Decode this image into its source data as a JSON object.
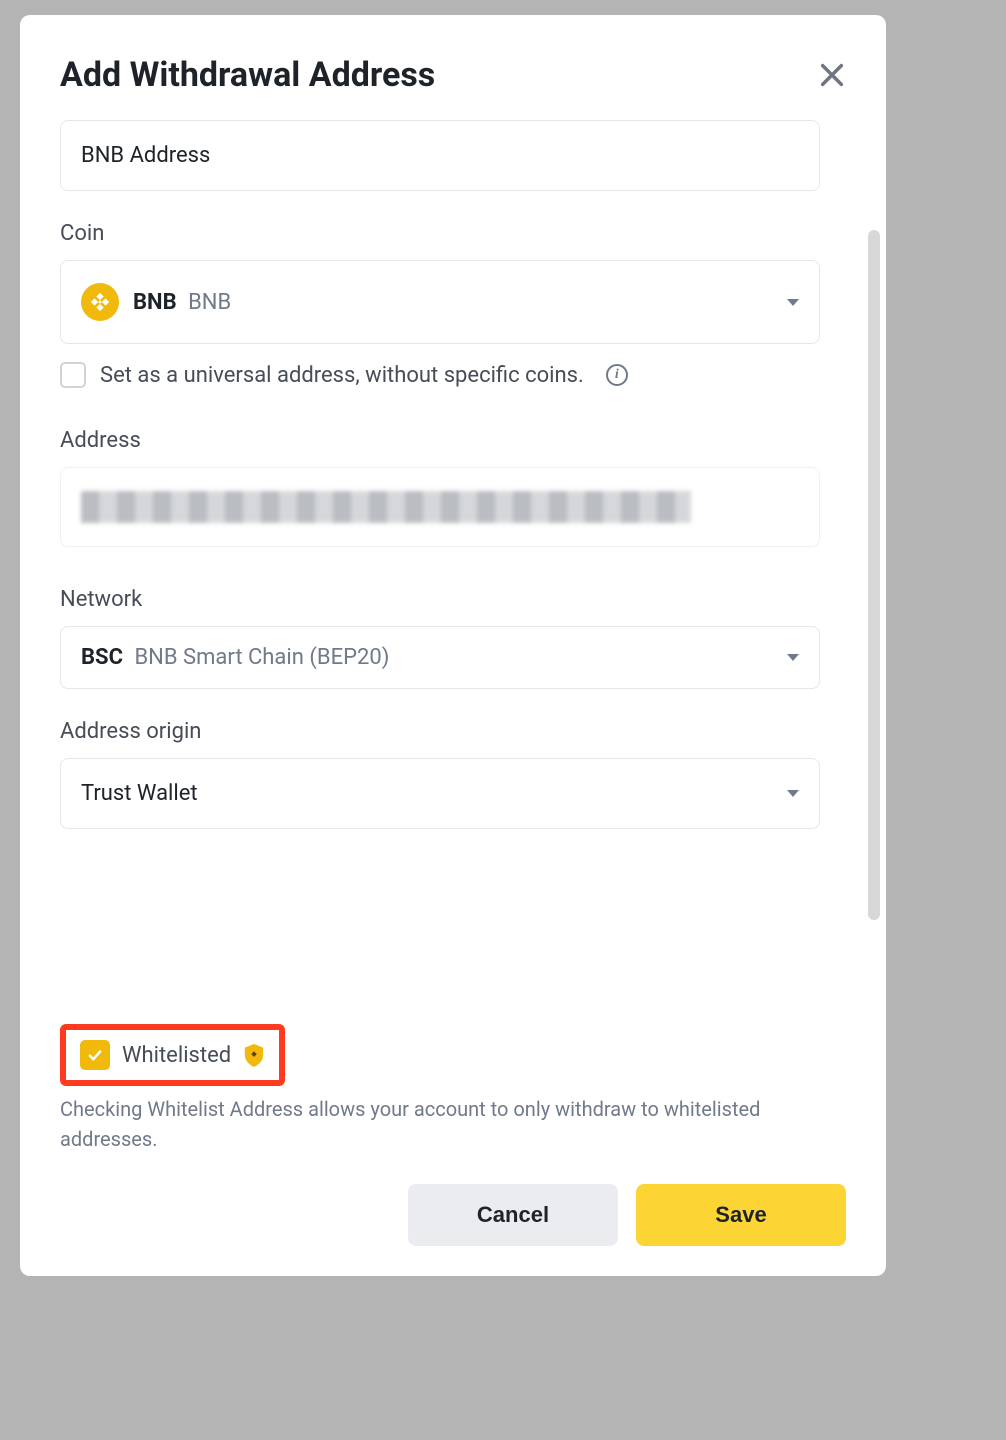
{
  "modal": {
    "title": "Add Withdrawal Address",
    "label_field": {
      "value": "BNB Address"
    },
    "coin": {
      "label": "Coin",
      "symbol": "BNB",
      "name": "BNB",
      "universal_checkbox_label": "Set as a universal address, without specific coins."
    },
    "address": {
      "label": "Address"
    },
    "network": {
      "label": "Network",
      "code": "BSC",
      "name": "BNB Smart Chain (BEP20)"
    },
    "origin": {
      "label": "Address origin",
      "value": "Trust Wallet"
    },
    "whitelist": {
      "label": "Whitelisted",
      "description": "Checking Whitelist Address allows your account to only withdraw to whitelisted addresses."
    },
    "buttons": {
      "cancel": "Cancel",
      "save": "Save"
    }
  }
}
